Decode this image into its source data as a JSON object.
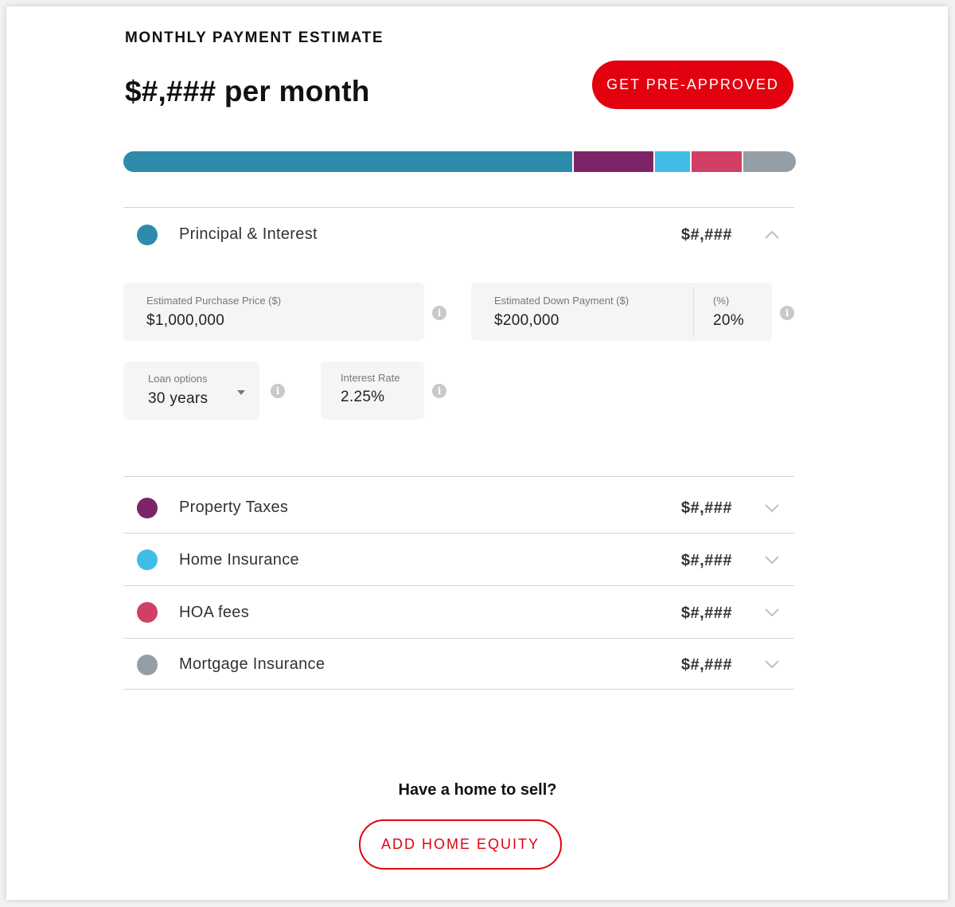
{
  "header": {
    "section_title": "MONTHLY PAYMENT ESTIMATE",
    "monthly_estimate": "$#,### per month",
    "cta_label": "GET PRE-APPROVED"
  },
  "breakdown_bar": [
    {
      "name": "Principal & Interest",
      "fraction": 0.67,
      "color": "#2e8bab"
    },
    {
      "name": "Property Taxes",
      "fraction": 0.12,
      "color": "#7d2468"
    },
    {
      "name": "Home Insurance",
      "fraction": 0.055,
      "color": "#3fbde6"
    },
    {
      "name": "HOA fees",
      "fraction": 0.077,
      "color": "#d13f67"
    },
    {
      "name": "Mortgage Insurance",
      "fraction": 0.078,
      "color": "#939ea6"
    }
  ],
  "principal": {
    "label": "Principal & Interest",
    "amount": "$#,###",
    "color": "#2e8bab",
    "expanded": true,
    "fields": {
      "purchase_price": {
        "label": "Estimated Purchase Price ($)",
        "value": "$1,000,000"
      },
      "down_payment": {
        "label": "Estimated Down Payment ($)",
        "value": "$200,000"
      },
      "down_payment_percent": {
        "label": "(%)",
        "value": "20%"
      },
      "loan_options": {
        "label": "Loan options",
        "value": "30 years"
      },
      "interest_rate": {
        "label": "Interest Rate",
        "value": "2.25%"
      }
    }
  },
  "rows": [
    {
      "label": "Property Taxes",
      "amount": "$#,###",
      "color": "#7d2468"
    },
    {
      "label": "Home Insurance",
      "amount": "$#,###",
      "color": "#3fbde6"
    },
    {
      "label": "HOA fees",
      "amount": "$#,###",
      "color": "#d13f67"
    },
    {
      "label": "Mortgage Insurance",
      "amount": "$#,###",
      "color": "#939ea6"
    }
  ],
  "footer": {
    "question": "Have a home to sell?",
    "button_label": "ADD HOME EQUITY"
  },
  "colors": {
    "brand_red": "#e3000f",
    "info_icon": "#c9c9c9"
  },
  "icons": {
    "info": "info-icon",
    "chevron_up": "chevron-up-icon",
    "chevron_down": "chevron-down-icon",
    "dropdown": "caret-down-icon"
  }
}
